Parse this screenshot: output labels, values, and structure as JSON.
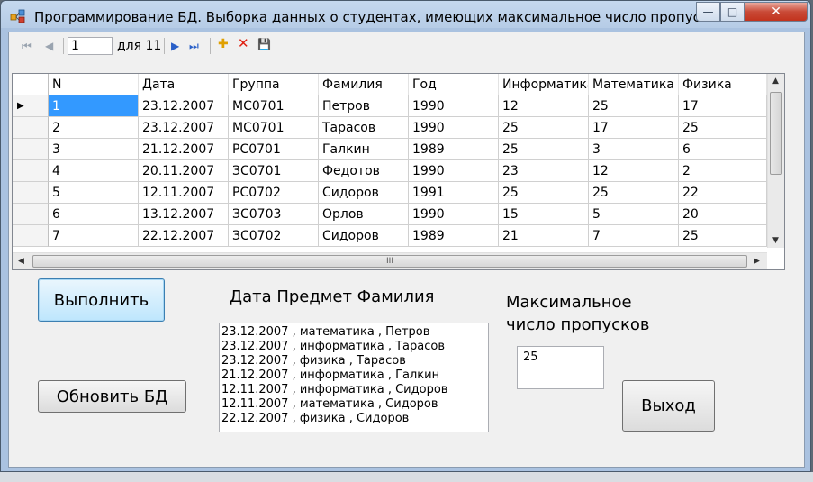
{
  "window": {
    "title": "Программирование БД. Выборка данных о студентах, имеющих максимальное число пропусков занятий",
    "min_glyph": "—",
    "max_glyph": "□",
    "close_glyph": "✕"
  },
  "navigator": {
    "position": "1",
    "count_label": "для 11",
    "first_glyph": "⏮",
    "prev_glyph": "◀",
    "next_glyph": "▶",
    "last_glyph": "⏭",
    "add_glyph": "✚",
    "delete_glyph": "✕",
    "save_glyph": "💾"
  },
  "grid": {
    "columns": [
      "N",
      "Дата",
      "Группа",
      "Фамилия",
      "Год",
      "Информатика",
      "Математика",
      "Физика"
    ],
    "current_row_marker": "▶",
    "rows": [
      [
        "1",
        "23.12.2007",
        "МС0701",
        "Петров",
        "1990",
        "12",
        "25",
        "17"
      ],
      [
        "2",
        "23.12.2007",
        "МС0701",
        "Тарасов",
        "1990",
        "25",
        "17",
        "25"
      ],
      [
        "3",
        "21.12.2007",
        "РС0701",
        "Галкин",
        "1989",
        "25",
        "3",
        "6"
      ],
      [
        "4",
        "20.11.2007",
        "ЗС0701",
        "Федотов",
        "1990",
        "23",
        "12",
        "2"
      ],
      [
        "5",
        "12.11.2007",
        "РС0702",
        "Сидоров",
        "1991",
        "25",
        "25",
        "22"
      ],
      [
        "6",
        "13.12.2007",
        "ЗС0703",
        "Орлов",
        "1990",
        "15",
        "5",
        "20"
      ],
      [
        "7",
        "22.12.2007",
        "ЗС0702",
        "Сидоров",
        "1989",
        "21",
        "7",
        "25"
      ]
    ],
    "hscroll_grip": "III"
  },
  "buttons": {
    "execute": "Выполнить",
    "refresh": "Обновить БД",
    "exit": "Выход"
  },
  "labels": {
    "result_header": "Дата  Предмет Фамилия",
    "max_line1": "Максимальное",
    "max_line2": "число пропусков"
  },
  "results": [
    "23.12.2007 , математика , Петров",
    "23.12.2007 , информатика , Тарасов",
    "23.12.2007 , физика , Тарасов",
    "21.12.2007 , информатика , Галкин",
    "12.11.2007 , информатика , Сидоров",
    "12.11.2007 , математика , Сидоров",
    "22.12.2007 , физика , Сидоров"
  ],
  "max_absences": "25"
}
